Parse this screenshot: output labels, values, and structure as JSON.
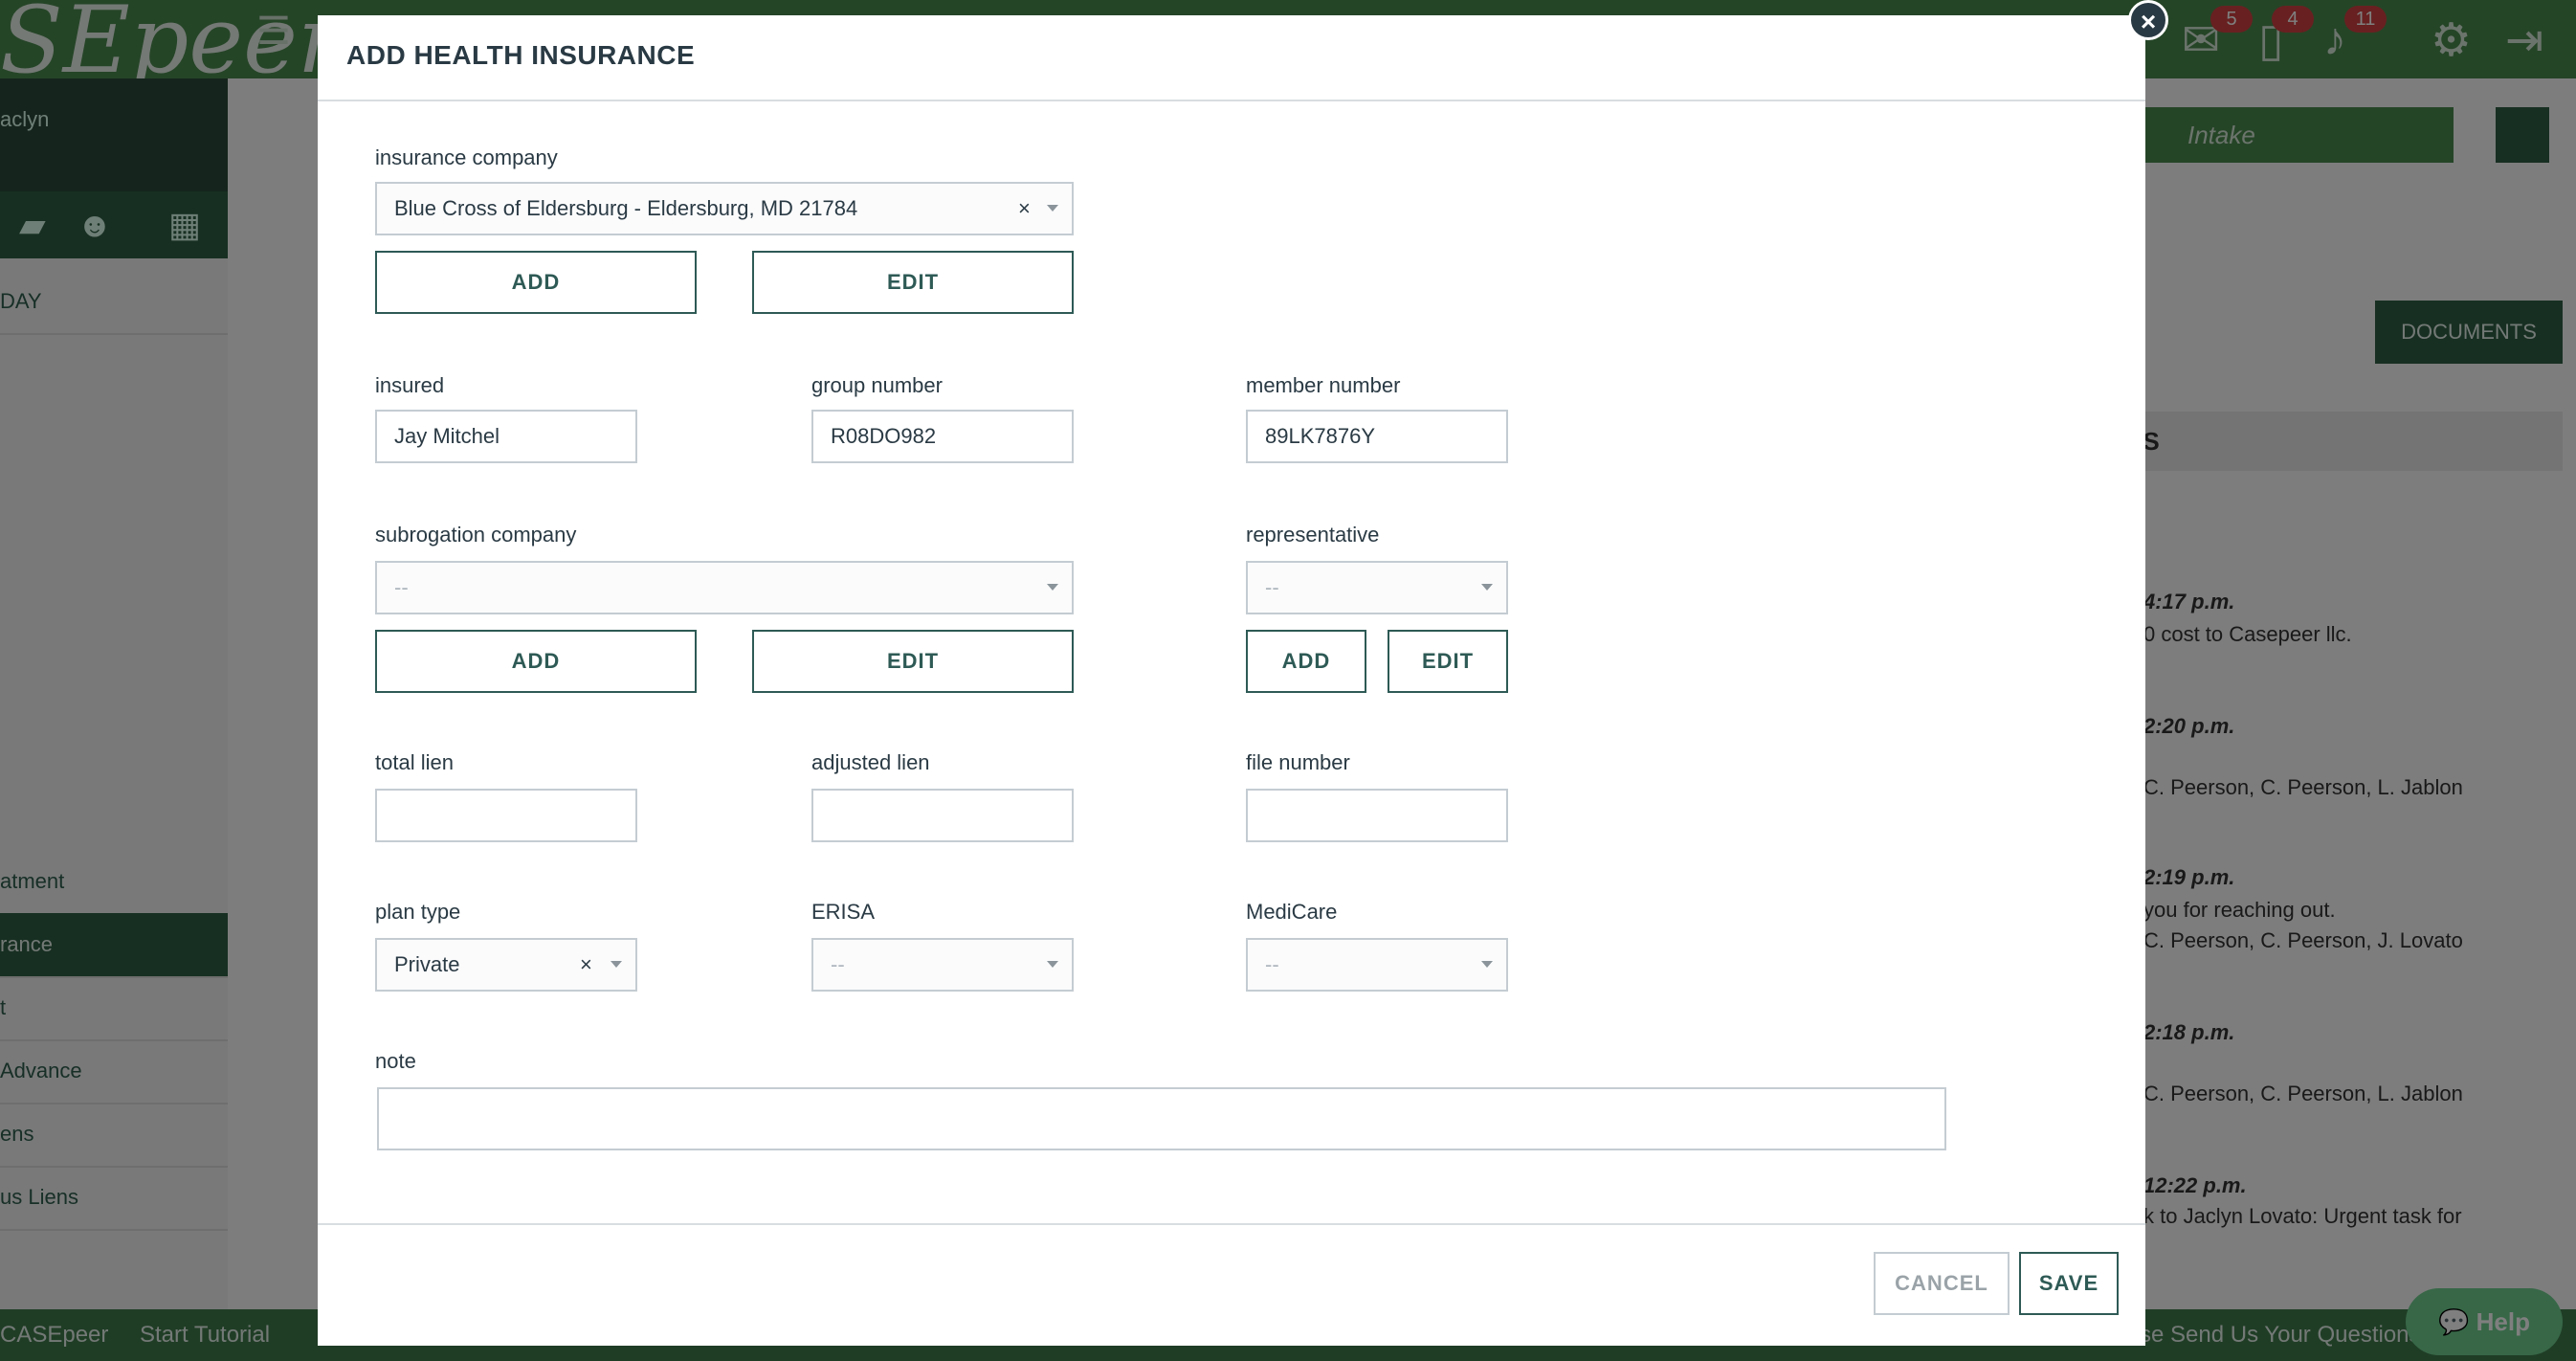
{
  "background": {
    "brand": "SEpeer",
    "user_name": "aclyn",
    "badges": [
      "5",
      "4",
      "11"
    ],
    "intake_label": "Intake",
    "documents_label": "DOCUMENTS",
    "notes_heading": "ES",
    "sidebar_items": [
      "atment",
      "rance",
      "t",
      "Advance",
      "ens",
      "us Liens"
    ],
    "sidebar_section": "DAY",
    "notes": [
      "4:17 p.m.",
      "0 cost to Casepeer llc.",
      "2:20 p.m.",
      "C. Peerson, C. Peerson, L. Jablon",
      "2:19 p.m.",
      "you for reaching out.",
      "C. Peerson, C. Peerson, J. Lovato",
      "2:18 p.m.",
      "C. Peerson, C. Peerson, L. Jablon",
      "12:22 p.m.",
      "k to Jaclyn Lovato: Urgent task for"
    ],
    "footer_brand": "CASEpeer",
    "footer_tutorial": "Start Tutorial",
    "footer_right": "se Send Us Your Questions",
    "help_label": "Help"
  },
  "modal": {
    "title": "ADD HEALTH INSURANCE",
    "close_label": "×",
    "insurance_company": {
      "label": "insurance company",
      "value": "Blue Cross of Eldersburg - Eldersburg, MD 21784",
      "add_label": "ADD",
      "edit_label": "EDIT"
    },
    "insured": {
      "label": "insured",
      "value": "Jay Mitchel"
    },
    "group_number": {
      "label": "group number",
      "value": "R08DO982"
    },
    "member_number": {
      "label": "member number",
      "value": "89LK7876Y"
    },
    "subrogation_company": {
      "label": "subrogation company",
      "value": "--",
      "add_label": "ADD",
      "edit_label": "EDIT"
    },
    "representative": {
      "label": "representative",
      "value": "--",
      "add_label": "ADD",
      "edit_label": "EDIT"
    },
    "total_lien": {
      "label": "total lien",
      "value": ""
    },
    "adjusted_lien": {
      "label": "adjusted lien",
      "value": ""
    },
    "file_number": {
      "label": "file number",
      "value": ""
    },
    "plan_type": {
      "label": "plan type",
      "value": "Private"
    },
    "erisa": {
      "label": "ERISA",
      "value": "--"
    },
    "medicare": {
      "label": "MediCare",
      "value": "--"
    },
    "note": {
      "label": "note",
      "value": ""
    },
    "cancel_label": "CANCEL",
    "save_label": "SAVE"
  }
}
